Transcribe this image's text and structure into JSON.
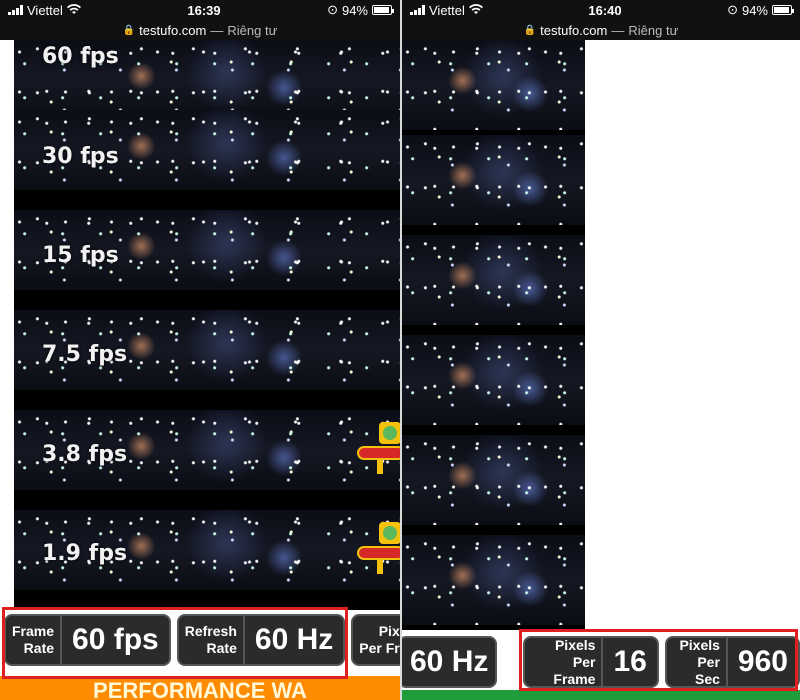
{
  "left_phone": {
    "status": {
      "carrier": "Viettel",
      "time": "16:39",
      "battery": "94%"
    },
    "url": {
      "domain": "testufo.com",
      "separator": "—",
      "mode": "Riêng tư"
    },
    "fps_labels": [
      "60 fps",
      "30 fps",
      "15 fps",
      "7.5 fps",
      "3.8 fps",
      "1.9 fps"
    ],
    "hud": {
      "frame_rate_label_1": "Frame",
      "frame_rate_label_2": "Rate",
      "frame_rate_value": "60 fps",
      "refresh_label_1": "Refresh",
      "refresh_label_2": "Rate",
      "refresh_value": "60 Hz",
      "ppf_label_1": "Pix",
      "ppf_label_2": "Per Fr"
    },
    "banner": "PERFORMANCE WA"
  },
  "right_phone": {
    "status": {
      "carrier": "Viettel",
      "time": "16:40",
      "battery": "94%"
    },
    "url": {
      "domain": "testufo.com",
      "separator": "—",
      "mode": "Riêng tư"
    },
    "hud": {
      "refresh_value": "60 Hz",
      "ppf_label_1": "Pixels",
      "ppf_label_2": "Per Frame",
      "ppf_value": "16",
      "pps_label_1": "Pixels",
      "pps_label_2": "Per Sec",
      "pps_value": "960"
    }
  },
  "colors": {
    "highlight": "#e02020",
    "banner": "#ff8c00",
    "green": "#1f9d3a"
  },
  "icons": [
    "signal-icon",
    "wifi-icon",
    "lock-icon",
    "alarm-icon",
    "battery-icon",
    "ufo-icon"
  ]
}
